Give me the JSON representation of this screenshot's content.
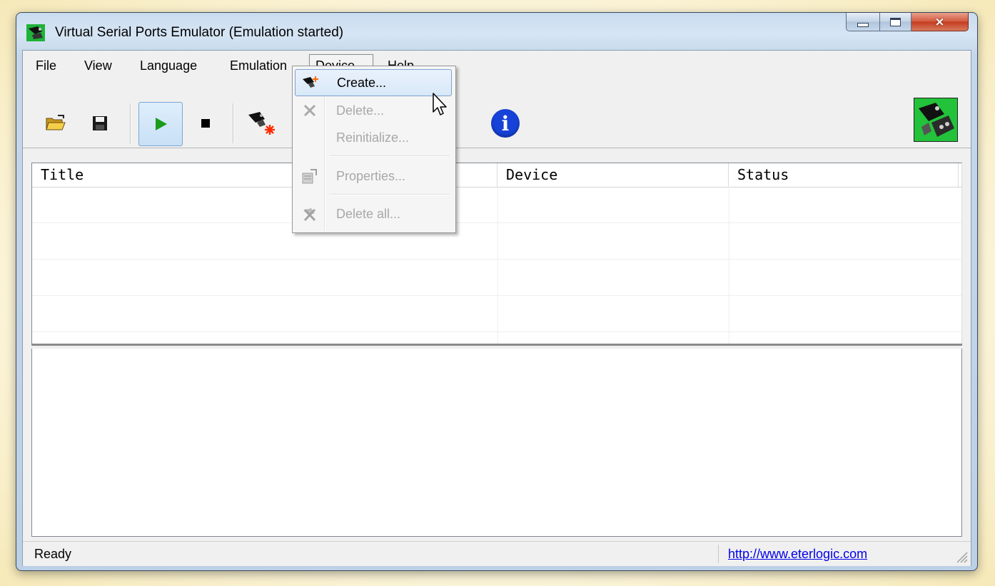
{
  "window": {
    "title": "Virtual Serial Ports Emulator (Emulation started)",
    "caption_buttons": {
      "minimize": "minimize-icon",
      "maximize": "maximize-icon",
      "close": "×"
    }
  },
  "menu": {
    "items": [
      {
        "id": "file",
        "label": "File"
      },
      {
        "id": "view",
        "label": "View"
      },
      {
        "id": "language",
        "label": "Language"
      },
      {
        "id": "emulation",
        "label": "Emulation"
      },
      {
        "id": "device",
        "label": "Device",
        "open": true
      },
      {
        "id": "help",
        "label": "Help"
      }
    ]
  },
  "toolbar": {
    "buttons": [
      {
        "id": "open",
        "icon": "folder-open-icon"
      },
      {
        "id": "save",
        "icon": "save-icon"
      },
      {
        "id": "start",
        "icon": "play-icon",
        "pressed": true
      },
      {
        "id": "stop",
        "icon": "stop-icon"
      },
      {
        "id": "create-device",
        "icon": "create-device-icon"
      },
      {
        "id": "delete-device",
        "icon": "delete-device-icon",
        "disabled": true
      },
      {
        "id": "about",
        "icon": "info-icon",
        "glyph": "i"
      }
    ]
  },
  "device_menu": {
    "items": [
      {
        "label": "Create...",
        "icon": "create-device-icon",
        "highlighted": true,
        "enabled": true
      },
      {
        "label": "Delete...",
        "icon": "delete-x-icon",
        "enabled": false
      },
      {
        "label": "Reinitialize...",
        "icon": "",
        "enabled": false
      },
      {
        "label": "Properties...",
        "icon": "properties-icon",
        "enabled": false
      },
      {
        "label": "Delete all...",
        "icon": "delete-all-icon",
        "enabled": false
      }
    ]
  },
  "device_list": {
    "columns": [
      "Title",
      "Device",
      "Status"
    ],
    "rows": []
  },
  "statusbar": {
    "text": "Ready",
    "link": "http://www.eterlogic.com"
  },
  "colors": {
    "info_blue": "#1742d8",
    "play_green": "#1b9c1b",
    "logo_green": "#22c33a",
    "highlight_border": "#7da2ce",
    "link": "#0000ee"
  }
}
